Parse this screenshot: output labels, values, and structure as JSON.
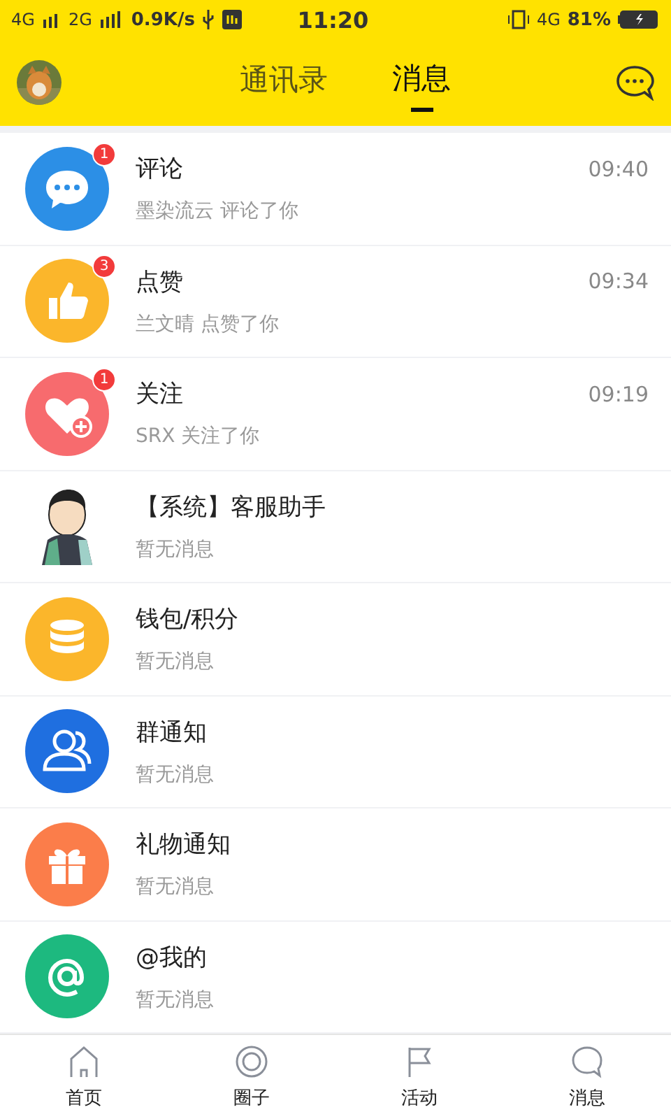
{
  "status_bar": {
    "network_1": "4G",
    "network_2": "2G",
    "speed": "0.9K/s",
    "time": "11:20",
    "network_3": "4G",
    "battery": "81%"
  },
  "header": {
    "tabs": [
      {
        "label": "通讯录",
        "selected": false
      },
      {
        "label": "消息",
        "selected": true
      }
    ]
  },
  "messages": [
    {
      "kind": "comment",
      "title": "评论",
      "subtitle": "墨染流云 评论了你",
      "time": "09:40",
      "badge": "1",
      "color": "#2c8fe6"
    },
    {
      "kind": "like",
      "title": "点赞",
      "subtitle": "兰文晴 点赞了你",
      "time": "09:34",
      "badge": "3",
      "color": "#fbb62b"
    },
    {
      "kind": "follow",
      "title": "关注",
      "subtitle": "SRX 关注了你",
      "time": "09:19",
      "badge": "1",
      "color": "#f76b6e"
    },
    {
      "kind": "system",
      "title": "【系统】客服助手",
      "subtitle": "暂无消息"
    },
    {
      "kind": "wallet",
      "title": "钱包/积分",
      "subtitle": "暂无消息",
      "color": "#fbb62b"
    },
    {
      "kind": "group",
      "title": "群通知",
      "subtitle": "暂无消息",
      "color": "#1f6fe0"
    },
    {
      "kind": "gift",
      "title": "礼物通知",
      "subtitle": "暂无消息",
      "color": "#fb7d4a"
    },
    {
      "kind": "mention",
      "title": "@我的",
      "subtitle": "暂无消息",
      "color": "#1db97f"
    }
  ],
  "bottom_nav": [
    {
      "kind": "home",
      "label": "首页"
    },
    {
      "kind": "circle",
      "label": "圈子"
    },
    {
      "kind": "activity",
      "label": "活动"
    },
    {
      "kind": "message",
      "label": "消息"
    }
  ]
}
